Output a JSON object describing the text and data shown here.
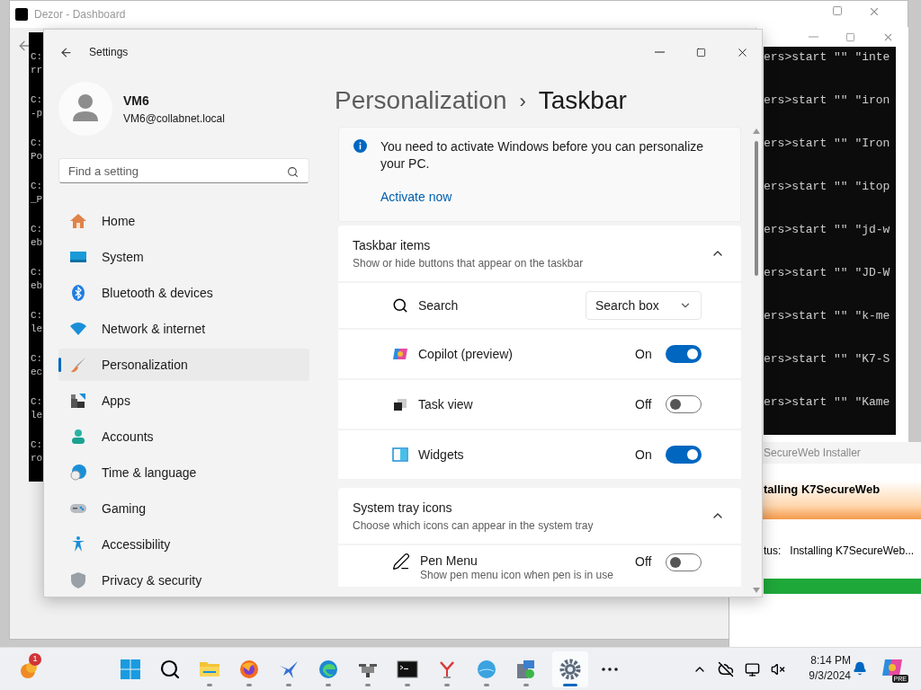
{
  "background_window": {
    "title": "Dezor - Dashboard"
  },
  "left_console": {
    "lines": [
      [
        "C:",
        "rr"
      ],
      [
        "C:",
        "-p"
      ],
      [
        "C:",
        "Po"
      ],
      [
        "C:",
        "_P"
      ],
      [
        "C:",
        "eb"
      ],
      [
        "C:",
        "eb"
      ],
      [
        "C:",
        "le"
      ],
      [
        "C:",
        "ec"
      ],
      [
        "C:",
        "le"
      ],
      [
        "C:",
        "ro"
      ]
    ]
  },
  "right_console": {
    "lines": [
      "ers>start \"\" \"inte",
      "ers>start \"\" \"iron",
      "ers>start \"\" \"Iron",
      "ers>start \"\" \"itop",
      "ers>start \"\" \"jd-w",
      "ers>start \"\" \"JD-W",
      "ers>start \"\" \"k-me",
      "ers>start \"\" \"K7-S",
      "ers>start \"\" \"Kame"
    ]
  },
  "settings": {
    "title": "Settings",
    "user": {
      "name": "VM6",
      "email": "VM6@collabnet.local"
    },
    "search": {
      "placeholder": "Find a setting"
    },
    "nav": [
      {
        "label": "Home",
        "selected": false
      },
      {
        "label": "System",
        "selected": false
      },
      {
        "label": "Bluetooth & devices",
        "selected": false
      },
      {
        "label": "Network & internet",
        "selected": false
      },
      {
        "label": "Personalization",
        "selected": true
      },
      {
        "label": "Apps",
        "selected": false
      },
      {
        "label": "Accounts",
        "selected": false
      },
      {
        "label": "Time & language",
        "selected": false
      },
      {
        "label": "Gaming",
        "selected": false
      },
      {
        "label": "Accessibility",
        "selected": false
      },
      {
        "label": "Privacy & security",
        "selected": false
      }
    ],
    "breadcrumb": {
      "parent": "Personalization",
      "separator": "›",
      "current": "Taskbar"
    },
    "notice": {
      "text": "You need to activate Windows before you can personalize your PC.",
      "link": "Activate now"
    },
    "sections": [
      {
        "title": "Taskbar items",
        "subtitle": "Show or hide buttons that appear on the taskbar",
        "expanded": true,
        "rows": [
          {
            "kind": "dropdown",
            "label": "Search",
            "value": "Search box"
          },
          {
            "kind": "toggle",
            "label": "Copilot (preview)",
            "state_text": "On",
            "on": true
          },
          {
            "kind": "toggle",
            "label": "Task view",
            "state_text": "Off",
            "on": false
          },
          {
            "kind": "toggle",
            "label": "Widgets",
            "state_text": "On",
            "on": true
          }
        ]
      },
      {
        "title": "System tray icons",
        "subtitle": "Choose which icons can appear in the system tray",
        "expanded": true,
        "rows": [
          {
            "kind": "toggle",
            "label": "Pen Menu",
            "description": "Show pen menu icon when pen is in use",
            "state_text": "Off",
            "on": false
          }
        ]
      }
    ]
  },
  "installer": {
    "title": "SecureWeb Installer",
    "heading": "talling K7SecureWeb",
    "status_label": "tus:",
    "status": "Installing K7SecureWeb...",
    "progress": {
      "level": 1
    }
  },
  "taskbar": {
    "notification_badge": "1",
    "apps": [
      {
        "running": false,
        "selected": false
      },
      {
        "running": false,
        "selected": false
      },
      {
        "running": false,
        "selected": false
      },
      {
        "running": true,
        "selected": false
      },
      {
        "running": true,
        "selected": false
      },
      {
        "running": true,
        "selected": false
      },
      {
        "running": true,
        "selected": false
      },
      {
        "running": true,
        "selected": false
      },
      {
        "running": true,
        "selected": false
      },
      {
        "running": true,
        "selected": false
      },
      {
        "running": true,
        "selected": false
      },
      {
        "running": true,
        "selected": false
      },
      {
        "running": true,
        "selected": true
      },
      {
        "running": false,
        "selected": false
      }
    ],
    "time": "8:14 PM",
    "date": "9/3/2024",
    "copilot_badge": "PRE"
  }
}
